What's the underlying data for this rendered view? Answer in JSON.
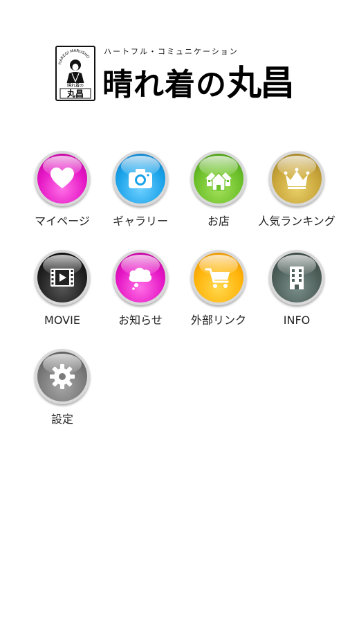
{
  "header": {
    "subtitle": "ハートフル・コミュニケーション",
    "title_prefix": "晴れ着の",
    "title_brand": "丸昌",
    "emblem_top_text": "HAREGI MARUSHO",
    "emblem_small_text": "晴れ着の",
    "emblem_brand_text": "丸昌"
  },
  "menu": {
    "items": [
      {
        "label": "マイページ",
        "icon": "heart-icon",
        "color": "#e516c5"
      },
      {
        "label": "ギャラリー",
        "icon": "camera-icon",
        "color": "#1ba3ea"
      },
      {
        "label": "お店",
        "icon": "houses-icon",
        "color": "#6cc02a"
      },
      {
        "label": "人気ランキング",
        "icon": "crown-icon",
        "color": "#c8a53a"
      },
      {
        "label": "MOVIE",
        "icon": "video-icon",
        "color": "#222222"
      },
      {
        "label": "お知らせ",
        "icon": "speech-bubble-icon",
        "color": "#e516c5"
      },
      {
        "label": "外部リンク",
        "icon": "cart-icon",
        "color": "#ffb40a"
      },
      {
        "label": "INFO",
        "icon": "building-icon",
        "color": "#4e5f5a"
      },
      {
        "label": "設定",
        "icon": "gear-icon",
        "color": "#7a7a7a"
      }
    ]
  }
}
